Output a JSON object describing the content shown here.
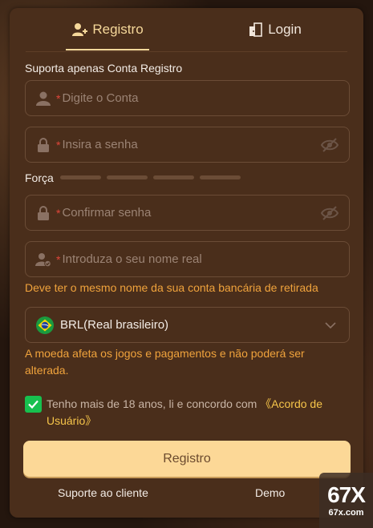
{
  "tabs": [
    {
      "label": "Registro",
      "icon": "add-user-icon",
      "active": true
    },
    {
      "label": "Login",
      "icon": "login-door-icon",
      "active": false
    }
  ],
  "form": {
    "account_label": "Suporta apenas Conta Registro",
    "account_placeholder": "Digite o Conta",
    "password_placeholder": "Insira a senha",
    "strength_label": "Força",
    "confirm_placeholder": "Confirmar senha",
    "realname_placeholder": "Introduza o seu nome real",
    "realname_hint": "Deve ter o mesmo nome da sua conta bancária de retirada",
    "currency_value": "BRL(Real brasileiro)",
    "currency_hint": "A moeda afeta os jogos e pagamentos e não poderá ser alterada.",
    "required_mark": "*",
    "strength_level": 0
  },
  "agreement": {
    "checked": true,
    "text": "Tenho mais de 18 anos, li e concordo com ",
    "link": "《Acordo de Usuário》"
  },
  "submit_label": "Registro",
  "footer": {
    "support": "Suporte ao cliente",
    "demo": "Demo"
  },
  "watermark": {
    "big": "67X",
    "small": "67x.com"
  },
  "colors": {
    "accent": "#f6d89a",
    "panel": "#4a2e1b",
    "hint": "#f0a33c",
    "checkbox": "#17c04f",
    "submit": "#fcd897"
  }
}
